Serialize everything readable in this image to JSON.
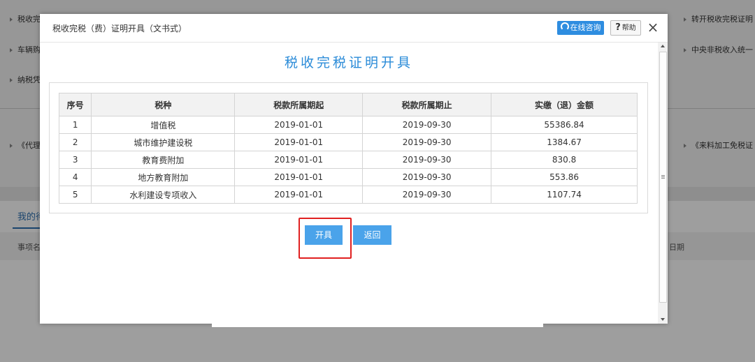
{
  "background": {
    "left_items": [
      "税收完",
      "车辆购",
      "纳税凭",
      "《代理"
    ],
    "right_items": [
      "转开税收完税证明",
      "中央非税收入统一",
      "《来料加工免税证"
    ],
    "tab_label": "我的待",
    "col_left": "事项名",
    "col_right": "日期"
  },
  "dialog": {
    "title": "税收完税（费）证明开具（文书式）",
    "consult_label": "在线咨询",
    "help_label": "帮助",
    "help_glyph": "?",
    "close_glyph": "×"
  },
  "content": {
    "heading": "税收完税证明开具",
    "table": {
      "headers": [
        "序号",
        "税种",
        "税款所属期起",
        "税款所属期止",
        "实缴（退）金额"
      ],
      "rows": [
        [
          "1",
          "增值税",
          "2019-01-01",
          "2019-09-30",
          "55386.84"
        ],
        [
          "2",
          "城市维护建设税",
          "2019-01-01",
          "2019-09-30",
          "1384.67"
        ],
        [
          "3",
          "教育费附加",
          "2019-01-01",
          "2019-09-30",
          "830.8"
        ],
        [
          "4",
          "地方教育附加",
          "2019-01-01",
          "2019-09-30",
          "553.86"
        ],
        [
          "5",
          "水利建设专项收入",
          "2019-01-01",
          "2019-09-30",
          "1107.74"
        ]
      ]
    },
    "buttons": {
      "issue": "开具",
      "back": "返回"
    }
  },
  "colors": {
    "accent": "#2a8bd8",
    "button": "#4aa3ea",
    "highlight": "#e02020"
  },
  "icons": [
    "headset-icon",
    "help-icon",
    "close-icon",
    "scroll-up-icon",
    "scroll-down-icon"
  ]
}
